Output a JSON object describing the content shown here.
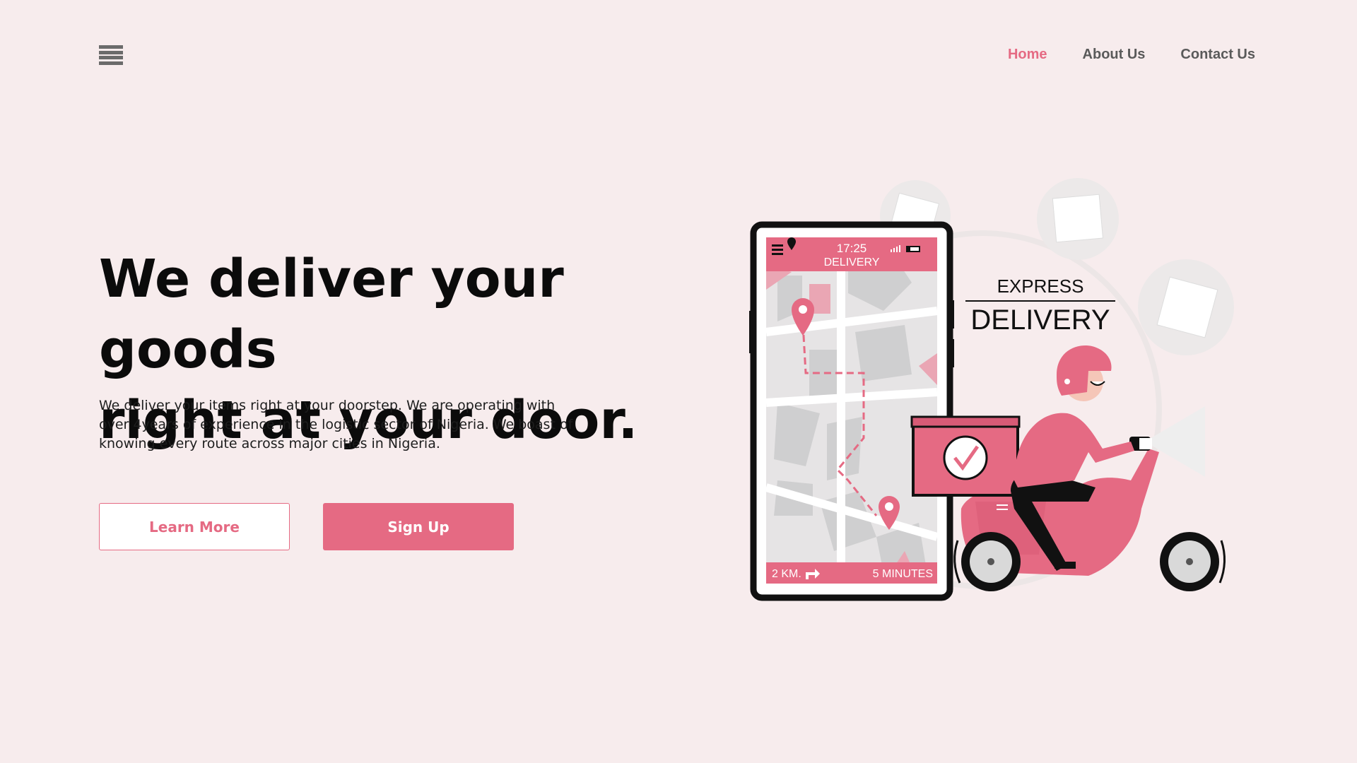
{
  "header": {
    "menu_icon": "hamburger-menu-icon",
    "nav": [
      {
        "label": "Home",
        "active": true
      },
      {
        "label": "About Us",
        "active": false
      },
      {
        "label": "Contact Us",
        "active": false
      }
    ]
  },
  "hero": {
    "title_line1": "We deliver your goods",
    "title_line2": "right at your door.",
    "description": "We deliver your items right at your doorstep. We are operating with over 4years of experience in the logistic sector of Nigeria. We boast of knowing every route across major cities in Nigeria.",
    "learn_more_label": "Learn More",
    "sign_up_label": "Sign Up"
  },
  "illustration": {
    "phone_time": "17:25",
    "phone_status": "DELIVERY",
    "distance": "2 KM.",
    "eta": "5 MINUTES",
    "express_label": "EXPRESS",
    "delivery_label": "DELIVERY"
  },
  "colors": {
    "accent": "#e56a83",
    "background": "#f7eced",
    "text": "#0b0b0b",
    "nav_inactive": "#5a5a5a"
  }
}
